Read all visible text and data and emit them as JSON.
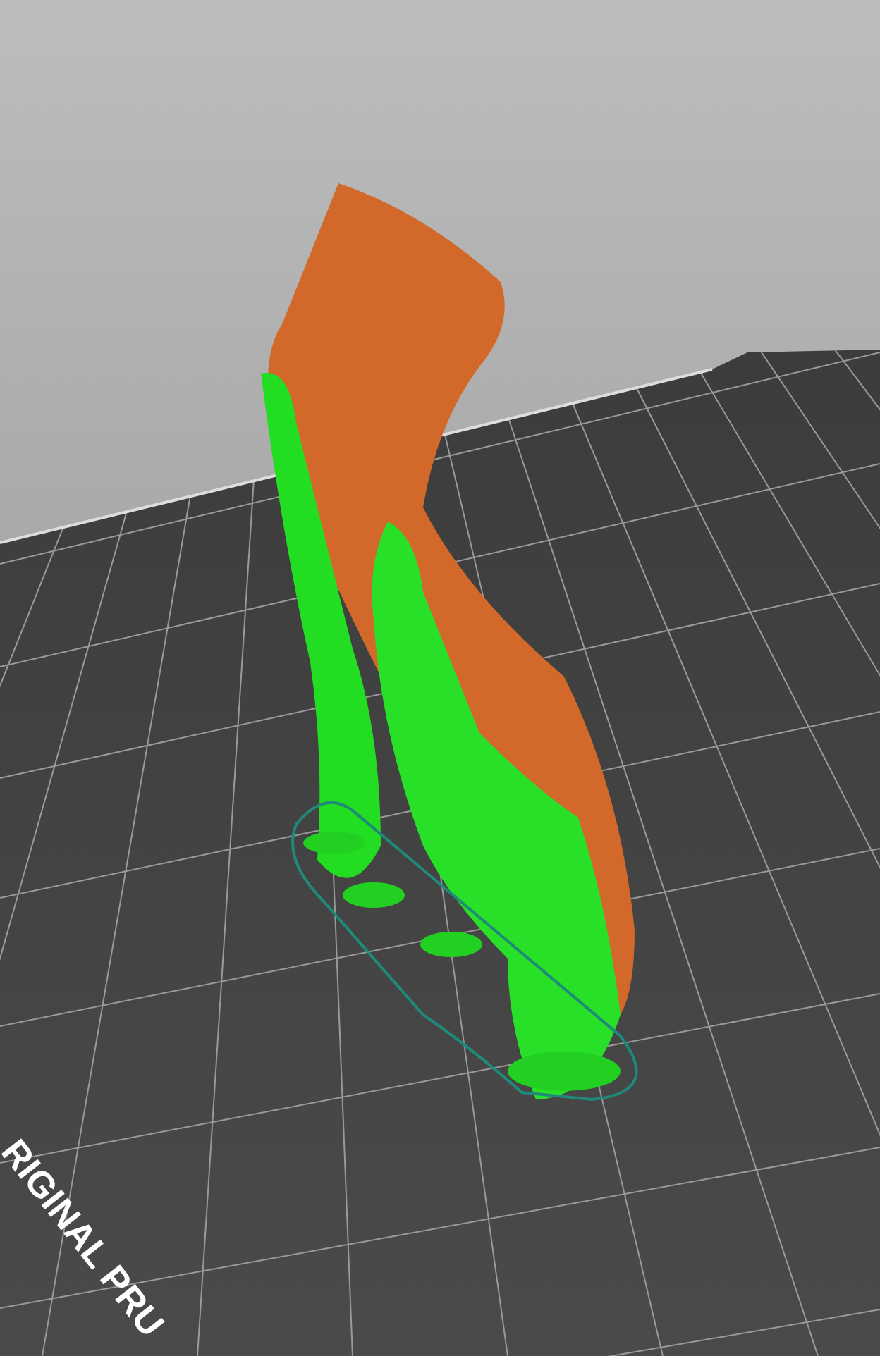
{
  "viewport": {
    "bed_label": "RIGINAL PRU"
  }
}
